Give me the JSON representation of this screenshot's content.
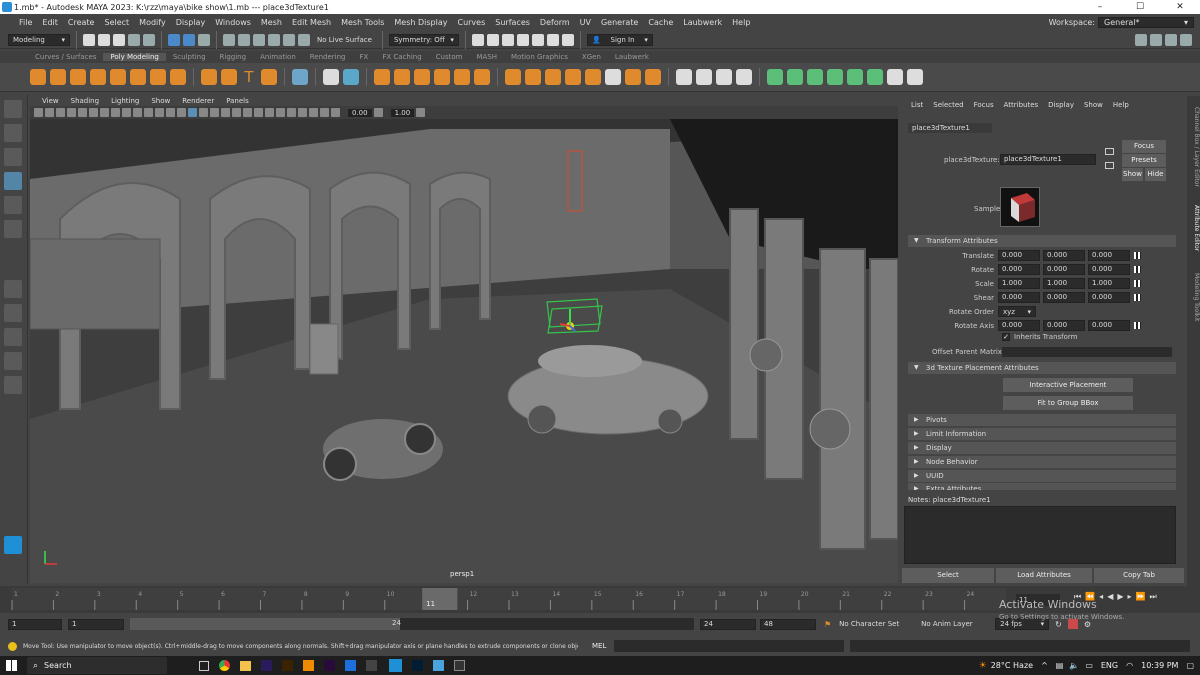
{
  "title_bar": {
    "text": "1.mb* - Autodesk MAYA 2023: K:\\rzz\\maya\\bike show\\1.mb   ---   place3dTexture1",
    "minimize": "–",
    "maximize": "☐",
    "close": "✕"
  },
  "menus": [
    "File",
    "Edit",
    "Create",
    "Select",
    "Modify",
    "Display",
    "Windows",
    "Mesh",
    "Edit Mesh",
    "Mesh Tools",
    "Mesh Display",
    "Curves",
    "Surfaces",
    "Deform",
    "UV",
    "Generate",
    "Cache",
    "Laubwerk",
    "Help"
  ],
  "workspace": {
    "label": "Workspace:",
    "value": "General*"
  },
  "status_line": {
    "mode": "Modeling",
    "live_surface": "No Live Surface",
    "symmetry": "Symmetry: Off",
    "sign_in": "Sign In"
  },
  "shelf_tabs": [
    "Curves / Surfaces",
    "Poly Modeling",
    "Sculpting",
    "Rigging",
    "Animation",
    "Rendering",
    "FX",
    "FX Caching",
    "Custom",
    "MASH",
    "Motion Graphics",
    "XGen",
    "Laubwerk"
  ],
  "shelf_active": "Poly Modeling",
  "viewport": {
    "menus": [
      "View",
      "Shading",
      "Lighting",
      "Show",
      "Renderer",
      "Panels"
    ],
    "near": "0.00",
    "far": "1.00",
    "camera_label": "persp1"
  },
  "ae": {
    "menus": [
      "List",
      "Selected",
      "Focus",
      "Attributes",
      "Display",
      "Show",
      "Help"
    ],
    "tab": "place3dTexture1",
    "node_label": "place3dTexture:",
    "node_value": "place3dTexture1",
    "focus": "Focus",
    "presets": "Presets",
    "show": "Show",
    "hide": "Hide",
    "sample_label": "Sample",
    "transform_section": "Transform Attributes",
    "attrs": [
      {
        "label": "Translate",
        "v": [
          "0.000",
          "0.000",
          "0.000"
        ]
      },
      {
        "label": "Rotate",
        "v": [
          "0.000",
          "0.000",
          "0.000"
        ]
      },
      {
        "label": "Scale",
        "v": [
          "1.000",
          "1.000",
          "1.000"
        ]
      },
      {
        "label": "Shear",
        "v": [
          "0.000",
          "0.000",
          "0.000"
        ]
      }
    ],
    "rotate_order_label": "Rotate Order",
    "rotate_order": "xyz",
    "rotate_axis": {
      "label": "Rotate Axis",
      "v": [
        "0.000",
        "0.000",
        "0.000"
      ]
    },
    "inherits": "Inherits Transform",
    "offset_parent": "Offset Parent Matrix",
    "placement_section": "3d Texture Placement Attributes",
    "interactive": "Interactive Placement",
    "fit_bbox": "Fit to Group BBox",
    "collapsed": [
      "Pivots",
      "Limit Information",
      "Display",
      "Node Behavior",
      "UUID",
      "Extra Attributes"
    ],
    "notes": "Notes:  place3dTexture1",
    "select": "Select",
    "load": "Load Attributes",
    "copy": "Copy Tab"
  },
  "side_tabs": [
    "Channel Box / Layer Editor",
    "Attribute Editor",
    "Modeling Toolkit"
  ],
  "timeline": {
    "ticks": [
      "1",
      "2",
      "3",
      "4",
      "5",
      "6",
      "7",
      "8",
      "9",
      "10",
      "11",
      "12",
      "13",
      "14",
      "15",
      "16",
      "17",
      "18",
      "19",
      "20",
      "21",
      "22",
      "23",
      "24"
    ],
    "current": "11",
    "current_field": "11"
  },
  "range": {
    "start": "1",
    "inner_start": "1",
    "slider_start": "1",
    "slider_end": "24",
    "end": "24",
    "anim_end": "48",
    "char_set": "No Character Set",
    "anim_layer": "No Anim Layer",
    "fps": "24 fps"
  },
  "help_text": "Move Tool: Use manipulator to move object(s). Ctrl+middle-drag to move components along normals. Shift+drag manipulator axis or plane handles to extrude components or clone objects. Ctrl+S",
  "mel_label": "MEL",
  "activate": {
    "title": "Activate Windows",
    "sub": "Go to Settings to activate Windows."
  },
  "taskbar": {
    "search": "Search",
    "weather": "28°C  Haze",
    "lang": "ENG",
    "time": "10:39 PM"
  }
}
